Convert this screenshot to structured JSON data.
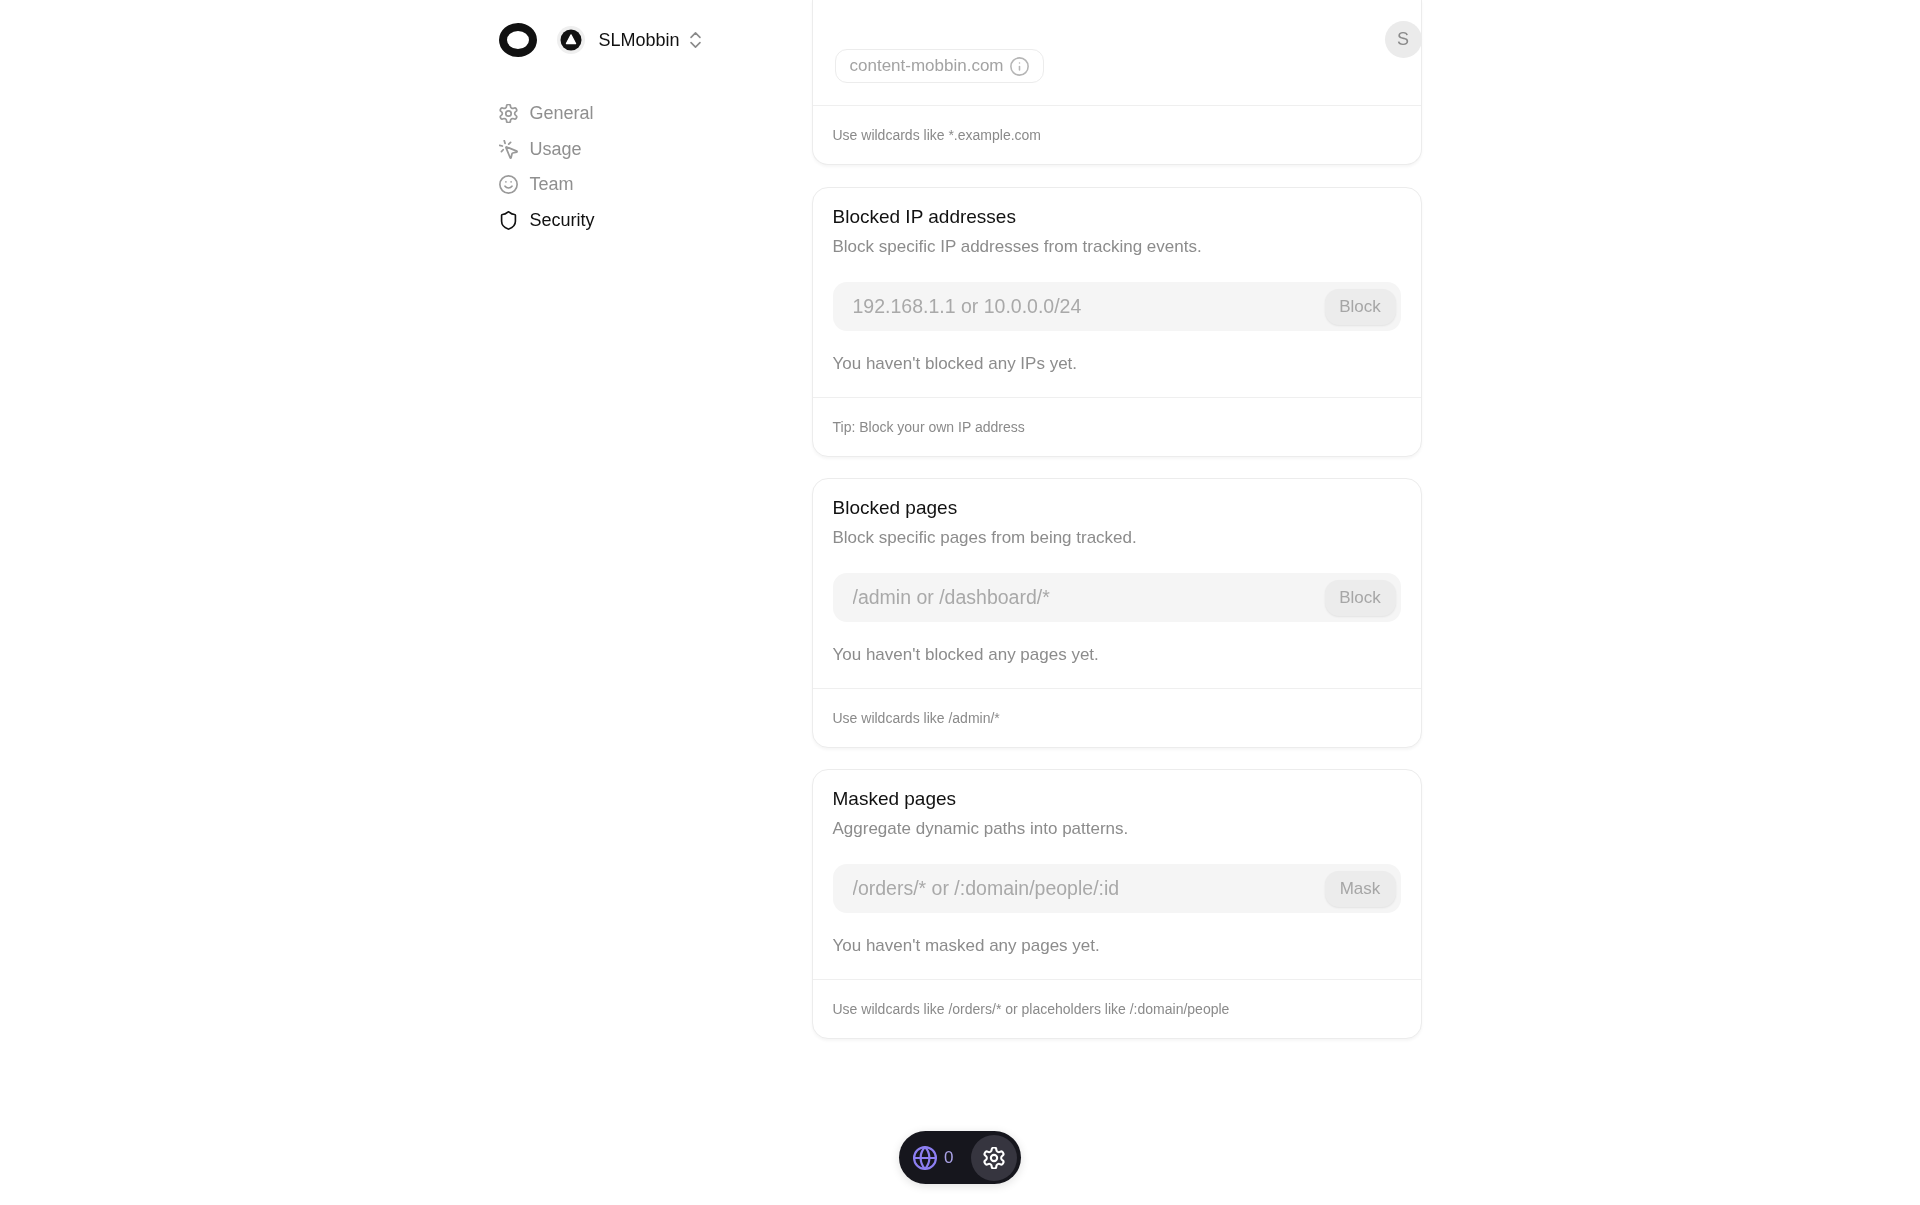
{
  "workspace": {
    "name": "SLMobbin"
  },
  "sidebar": {
    "items": [
      {
        "label": "General",
        "selected": false
      },
      {
        "label": "Usage",
        "selected": false
      },
      {
        "label": "Team",
        "selected": false
      },
      {
        "label": "Security",
        "selected": true
      }
    ]
  },
  "user": {
    "initial": "S"
  },
  "domains_card": {
    "chip": "content-mobbin.com",
    "hint": "Use wildcards like *.example.com"
  },
  "cards": [
    {
      "title": "Blocked IP addresses",
      "description": "Block specific IP addresses from tracking events.",
      "input": {
        "placeholder": "192.168.1.1 or 10.0.0.0/24"
      },
      "button": {
        "label": "Block",
        "disabled": true
      },
      "empty_message": "You haven't blocked any IPs yet.",
      "hint": "Tip: Block your own IP address"
    },
    {
      "title": "Blocked pages",
      "description": "Block specific pages from being tracked.",
      "input": {
        "placeholder": "/admin or /dashboard/*"
      },
      "button": {
        "label": "Block",
        "disabled": true
      },
      "empty_message": "You haven't blocked any pages yet.",
      "hint": "Use wildcards like /admin/*"
    },
    {
      "title": "Masked pages",
      "description": "Aggregate dynamic paths into patterns.",
      "input": {
        "placeholder": "/orders/* or /:domain/people/:id"
      },
      "button": {
        "label": "Mask",
        "disabled": true
      },
      "empty_message": "You haven't masked any pages yet.",
      "hint": "Use wildcards like /orders/* or placeholders like /:domain/people"
    }
  ],
  "toolbar": {
    "count": "0"
  }
}
